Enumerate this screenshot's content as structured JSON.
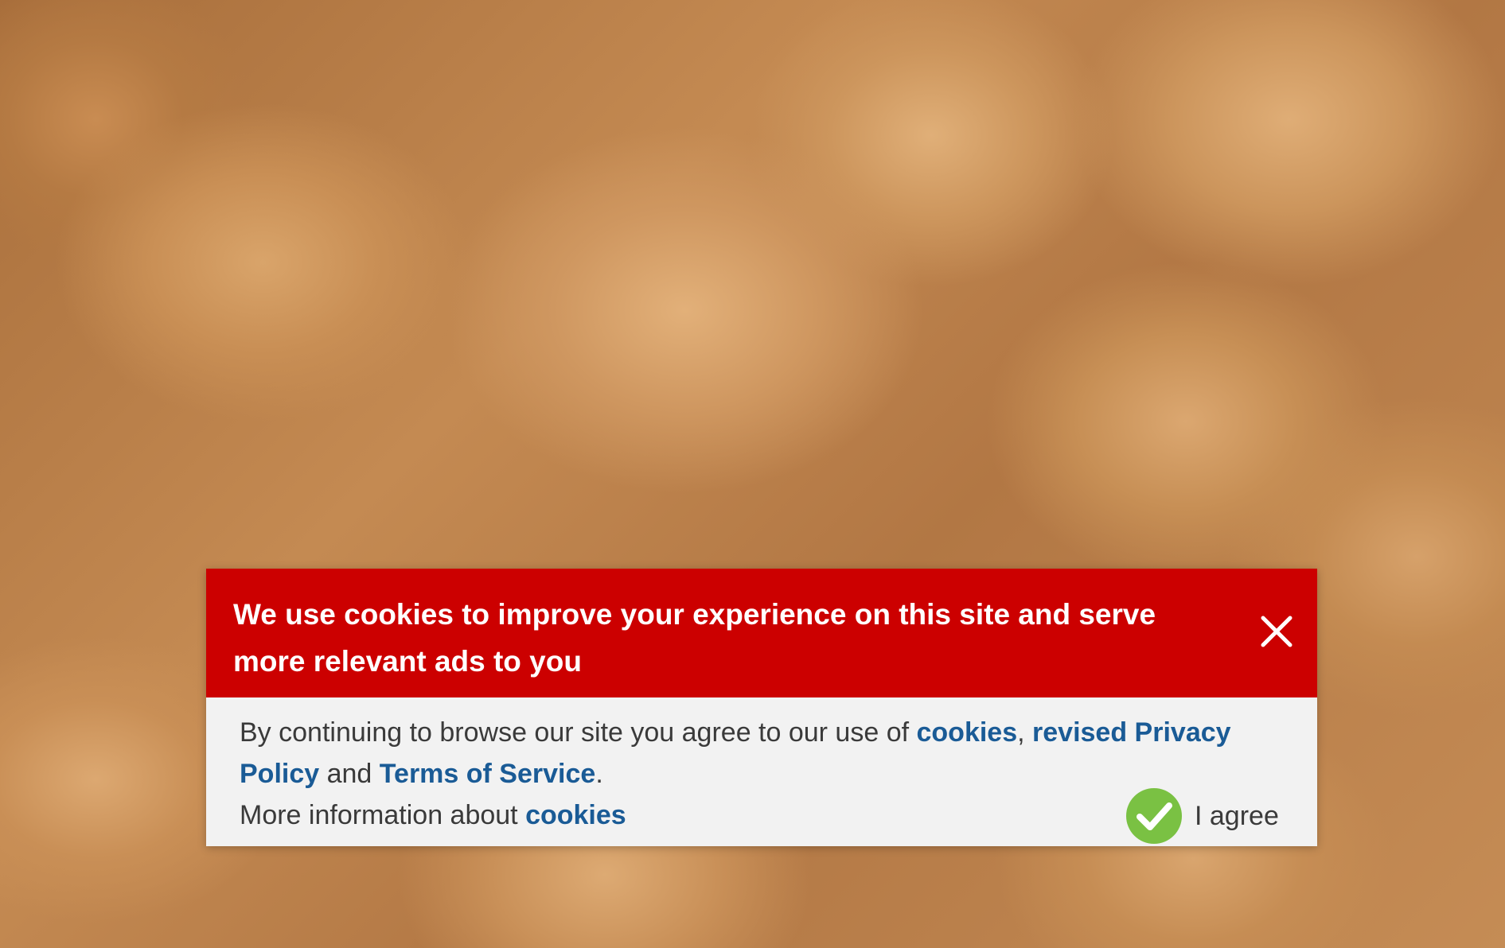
{
  "consent": {
    "title": "We use cookies to improve your experience on this site and serve more relevant ads to you",
    "body_prefix": "By continuing to browse our site you agree to our use of ",
    "cookies_link": "cookies",
    "comma": ", ",
    "privacy_link": "revised Privacy Policy",
    "and_text": " and ",
    "terms_link": "Terms of Service",
    "period": ".",
    "more_info_text": "More information about ",
    "more_info_link": "cookies",
    "agree_label": "I agree",
    "close_icon": "close-icon",
    "agree_icon": "check-circle-icon"
  },
  "colors": {
    "header_bg": "#cc0000",
    "body_bg": "#f2f2f2",
    "link": "#1a5b96",
    "agree_green": "#7ac143"
  }
}
